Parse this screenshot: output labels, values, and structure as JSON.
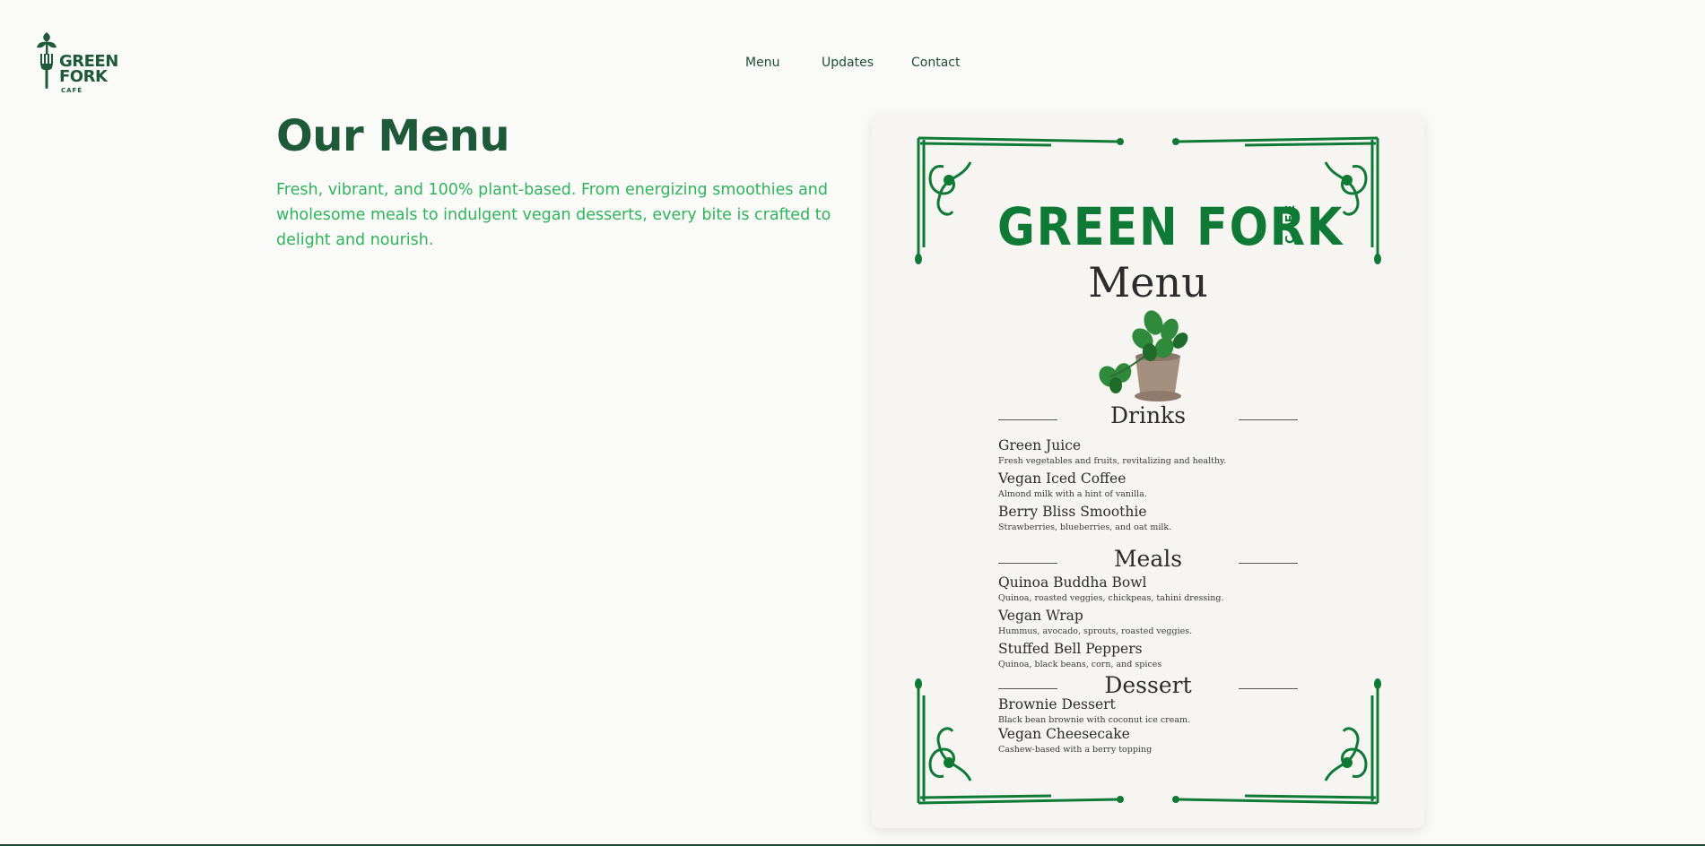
{
  "brand": {
    "logo_line1": "GREEN",
    "logo_line2": "FORK",
    "logo_cafe": "CAFÉ"
  },
  "nav": {
    "items": [
      {
        "label": "Menu"
      },
      {
        "label": "Updates"
      },
      {
        "label": "Contact"
      }
    ]
  },
  "hero": {
    "title": "Our Menu",
    "intro": "Fresh, vibrant, and 100% plant-based. From energizing smoothies and wholesome meals to indulgent vegan desserts, every bite is crafted to delight and nourish."
  },
  "menu_card": {
    "brand": "GREEN FORK",
    "brand_cafe": "CAFÉ",
    "heading": "Menu",
    "sections": [
      {
        "title": "Drinks",
        "items": [
          {
            "name": "Green Juice",
            "desc": "Fresh vegetables and fruits, revitalizing and healthy."
          },
          {
            "name": "Vegan Iced Coffee",
            "desc": "Almond milk with a hint of vanilla."
          },
          {
            "name": "Berry Bliss Smoothie",
            "desc": "Strawberries, blueberries, and oat milk."
          }
        ]
      },
      {
        "title": "Meals",
        "items": [
          {
            "name": "Quinoa Buddha Bowl",
            "desc": "Quinoa, roasted veggies, chickpeas, tahini dressing."
          },
          {
            "name": "Vegan Wrap",
            "desc": "Hummus, avocado, sprouts, roasted veggies."
          },
          {
            "name": "Stuffed Bell Peppers",
            "desc": "Quinoa, black beans, corn, and spices"
          }
        ]
      },
      {
        "title": "Dessert",
        "items": [
          {
            "name": "Brownie Dessert",
            "desc": "Black bean brownie with coconut ice cream."
          },
          {
            "name": "Vegan Cheesecake",
            "desc": "Cashew-based with a berry topping"
          }
        ]
      }
    ]
  },
  "colors": {
    "brand_dark_green": "#1e5a3a",
    "accent_green": "#2fb45a",
    "ornament_green": "#0f7a35",
    "background": "#fafaf8"
  },
  "icons": {
    "logo": "fork-sprout-icon",
    "plant": "potted-plant-icon"
  }
}
